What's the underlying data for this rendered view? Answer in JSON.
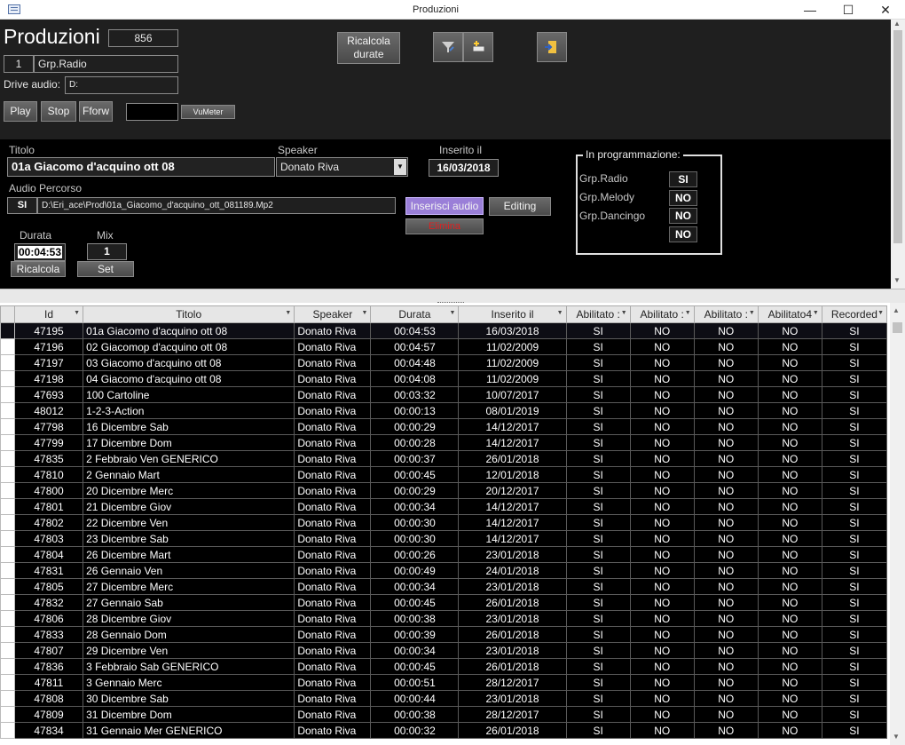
{
  "window": {
    "title": "Produzioni",
    "min": "—",
    "max": "☐",
    "close": "✕"
  },
  "header": {
    "title": "Produzioni",
    "count": "856",
    "group_id": "1",
    "group_name": "Grp.Radio",
    "drive_label": "Drive audio:",
    "drive_value": "D:",
    "play": "Play",
    "stop": "Stop",
    "fforw": "Fforw",
    "vumeter": "VuMeter",
    "ricalcola_durate": "Ricalcola\ndurate"
  },
  "detail": {
    "titolo_label": "Titolo",
    "titolo_value": "01a Giacomo d'acquino ott 08",
    "speaker_label": "Speaker",
    "speaker_value": "Donato Riva",
    "inserito_label": "Inserito il",
    "inserito_value": "16/03/2018",
    "audio_label": "Audio",
    "percorso_label": "Percorso",
    "audio_value": "SI",
    "percorso_value": "D:\\Eri_ace\\Prod\\01a_Giacomo_d'acquino_ott_081189.Mp2",
    "inserisci": "Inserisci audio",
    "editing": "Editing",
    "elimina": "Elimina",
    "durata_label": "Durata",
    "durata_value": "00:04:53",
    "mix_label": "Mix",
    "mix_value": "1",
    "ricalcola": "Ricalcola",
    "set": "Set"
  },
  "programmazione": {
    "title": "In programmazione:",
    "items": [
      {
        "name": "Grp.Radio",
        "value": "SI"
      },
      {
        "name": "Grp.Melody",
        "value": "NO"
      },
      {
        "name": "Grp.Dancingo",
        "value": "NO"
      },
      {
        "name": "",
        "value": "NO"
      }
    ]
  },
  "table": {
    "columns": [
      "Id",
      "Titolo",
      "Speaker",
      "Durata",
      "Inserito il",
      "Abilitato :",
      "Abilitato :",
      "Abilitato :",
      "Abilitato4",
      "Recorded"
    ],
    "rows": [
      [
        "47195",
        "01a Giacomo d'acquino ott 08",
        "Donato Riva",
        "00:04:53",
        "16/03/2018",
        "SI",
        "NO",
        "NO",
        "NO",
        "SI"
      ],
      [
        "47196",
        "02 Giacomop d'acquino ott 08",
        "Donato Riva",
        "00:04:57",
        "11/02/2009",
        "SI",
        "NO",
        "NO",
        "NO",
        "SI"
      ],
      [
        "47197",
        "03 Giacomo d'acquino ott 08",
        "Donato Riva",
        "00:04:48",
        "11/02/2009",
        "SI",
        "NO",
        "NO",
        "NO",
        "SI"
      ],
      [
        "47198",
        "04 Giacomo d'acquino ott 08",
        "Donato Riva",
        "00:04:08",
        "11/02/2009",
        "SI",
        "NO",
        "NO",
        "NO",
        "SI"
      ],
      [
        "47693",
        "100 Cartoline",
        "Donato Riva",
        "00:03:32",
        "10/07/2017",
        "SI",
        "NO",
        "NO",
        "NO",
        "SI"
      ],
      [
        "48012",
        "1-2-3-Action",
        "Donato Riva",
        "00:00:13",
        "08/01/2019",
        "SI",
        "NO",
        "NO",
        "NO",
        "SI"
      ],
      [
        "47798",
        "16 Dicembre Sab",
        "Donato Riva",
        "00:00:29",
        "14/12/2017",
        "SI",
        "NO",
        "NO",
        "NO",
        "SI"
      ],
      [
        "47799",
        "17 Dicembre Dom",
        "Donato Riva",
        "00:00:28",
        "14/12/2017",
        "SI",
        "NO",
        "NO",
        "NO",
        "SI"
      ],
      [
        "47835",
        "2 Febbraio Ven GENERICO",
        "Donato Riva",
        "00:00:37",
        "26/01/2018",
        "SI",
        "NO",
        "NO",
        "NO",
        "SI"
      ],
      [
        "47810",
        "2 Gennaio Mart",
        "Donato Riva",
        "00:00:45",
        "12/01/2018",
        "SI",
        "NO",
        "NO",
        "NO",
        "SI"
      ],
      [
        "47800",
        "20 Dicembre Merc",
        "Donato Riva",
        "00:00:29",
        "20/12/2017",
        "SI",
        "NO",
        "NO",
        "NO",
        "SI"
      ],
      [
        "47801",
        "21 Dicembre Giov",
        "Donato Riva",
        "00:00:34",
        "14/12/2017",
        "SI",
        "NO",
        "NO",
        "NO",
        "SI"
      ],
      [
        "47802",
        "22 Dicembre Ven",
        "Donato Riva",
        "00:00:30",
        "14/12/2017",
        "SI",
        "NO",
        "NO",
        "NO",
        "SI"
      ],
      [
        "47803",
        "23 Dicembre Sab",
        "Donato Riva",
        "00:00:30",
        "14/12/2017",
        "SI",
        "NO",
        "NO",
        "NO",
        "SI"
      ],
      [
        "47804",
        "26 Dicembre Mart",
        "Donato Riva",
        "00:00:26",
        "23/01/2018",
        "SI",
        "NO",
        "NO",
        "NO",
        "SI"
      ],
      [
        "47831",
        "26 Gennaio Ven",
        "Donato Riva",
        "00:00:49",
        "24/01/2018",
        "SI",
        "NO",
        "NO",
        "NO",
        "SI"
      ],
      [
        "47805",
        "27 Dicembre Merc",
        "Donato Riva",
        "00:00:34",
        "23/01/2018",
        "SI",
        "NO",
        "NO",
        "NO",
        "SI"
      ],
      [
        "47832",
        "27 Gennaio Sab",
        "Donato Riva",
        "00:00:45",
        "26/01/2018",
        "SI",
        "NO",
        "NO",
        "NO",
        "SI"
      ],
      [
        "47806",
        "28 Dicembre Giov",
        "Donato Riva",
        "00:00:38",
        "23/01/2018",
        "SI",
        "NO",
        "NO",
        "NO",
        "SI"
      ],
      [
        "47833",
        "28 Gennaio Dom",
        "Donato Riva",
        "00:00:39",
        "26/01/2018",
        "SI",
        "NO",
        "NO",
        "NO",
        "SI"
      ],
      [
        "47807",
        "29 Dicembre Ven",
        "Donato Riva",
        "00:00:34",
        "23/01/2018",
        "SI",
        "NO",
        "NO",
        "NO",
        "SI"
      ],
      [
        "47836",
        "3 Febbraio Sab GENERICO",
        "Donato Riva",
        "00:00:45",
        "26/01/2018",
        "SI",
        "NO",
        "NO",
        "NO",
        "SI"
      ],
      [
        "47811",
        "3 Gennaio Merc",
        "Donato Riva",
        "00:00:51",
        "28/12/2017",
        "SI",
        "NO",
        "NO",
        "NO",
        "SI"
      ],
      [
        "47808",
        "30 Dicembre Sab",
        "Donato Riva",
        "00:00:44",
        "23/01/2018",
        "SI",
        "NO",
        "NO",
        "NO",
        "SI"
      ],
      [
        "47809",
        "31 Dicembre Dom",
        "Donato Riva",
        "00:00:38",
        "28/12/2017",
        "SI",
        "NO",
        "NO",
        "NO",
        "SI"
      ],
      [
        "47834",
        "31 Gennaio Mer GENERICO",
        "Donato Riva",
        "00:00:32",
        "26/01/2018",
        "SI",
        "NO",
        "NO",
        "NO",
        "SI"
      ]
    ]
  },
  "colors": {
    "elimina_text": "#e02020",
    "inserisci_bg": "#9a7fd8"
  }
}
